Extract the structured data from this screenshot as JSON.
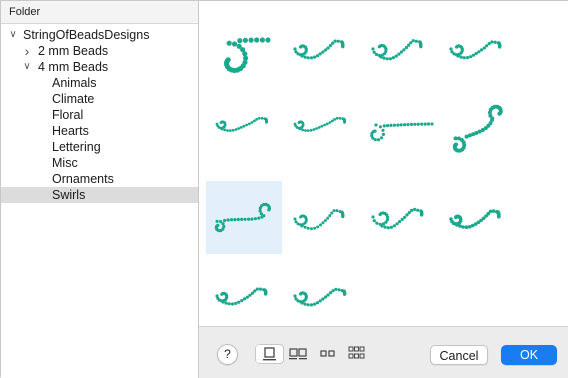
{
  "sidebar": {
    "header": "Folder",
    "tree": [
      {
        "label": "StringOfBeadsDesigns",
        "level": 0,
        "chevron": "chevron-down",
        "selected": false
      },
      {
        "label": "2 mm Beads",
        "level": 1,
        "chevron": "chevron-right",
        "selected": false
      },
      {
        "label": "4 mm Beads",
        "level": 1,
        "chevron": "chevron-down",
        "selected": false
      },
      {
        "label": "Animals",
        "level": 2,
        "chevron": "",
        "selected": false
      },
      {
        "label": "Climate",
        "level": 2,
        "chevron": "",
        "selected": false
      },
      {
        "label": "Floral",
        "level": 2,
        "chevron": "",
        "selected": false
      },
      {
        "label": "Hearts",
        "level": 2,
        "chevron": "",
        "selected": false
      },
      {
        "label": "Lettering",
        "level": 2,
        "chevron": "",
        "selected": false
      },
      {
        "label": "Misc",
        "level": 2,
        "chevron": "",
        "selected": false
      },
      {
        "label": "Ornaments",
        "level": 2,
        "chevron": "",
        "selected": false
      },
      {
        "label": "Swirls",
        "level": 2,
        "chevron": "",
        "selected": true
      }
    ]
  },
  "designs": {
    "bead_color": "#1ba88c",
    "selected_index": 8,
    "items": [
      {
        "name": "swirl-design-1"
      },
      {
        "name": "swirl-design-2"
      },
      {
        "name": "swirl-design-3"
      },
      {
        "name": "swirl-design-4"
      },
      {
        "name": "swirl-design-5"
      },
      {
        "name": "swirl-design-6"
      },
      {
        "name": "swirl-design-7"
      },
      {
        "name": "swirl-design-8"
      },
      {
        "name": "swirl-design-9"
      },
      {
        "name": "swirl-design-10"
      },
      {
        "name": "swirl-design-11"
      },
      {
        "name": "swirl-design-12"
      },
      {
        "name": "swirl-design-13"
      },
      {
        "name": "swirl-design-14"
      }
    ]
  },
  "footer": {
    "help_label": "?",
    "view_modes": [
      "single-view-icon",
      "double-view-icon",
      "small-double-view-icon",
      "grid-view-icon"
    ],
    "active_view_mode": 0,
    "cancel_label": "Cancel",
    "ok_label": "OK",
    "ok_color": "#1a7cf2"
  }
}
